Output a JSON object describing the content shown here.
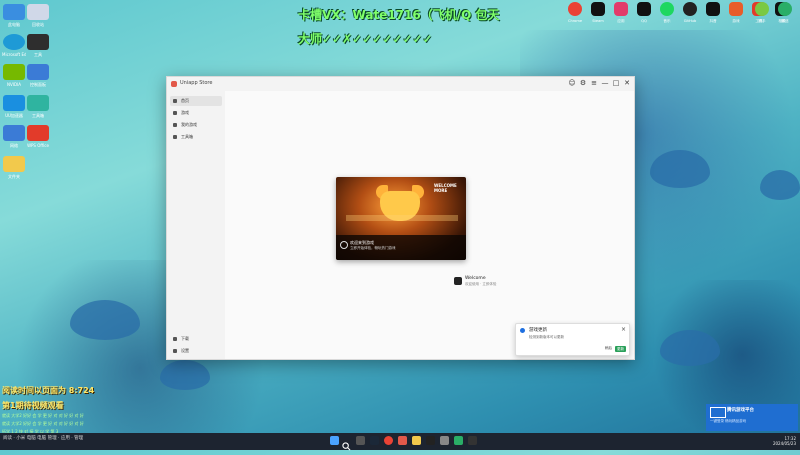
{
  "overlay": {
    "title_line1": "卡槽VX：Wate1716（飞机/Q 包天",
    "title_line2": "大师✓✓✗✓✓✓✓✓✓✓✓",
    "left_line1": "阅读时间以页面为 8:724",
    "left_line2": "第1期待视频观看",
    "left_small1": "就读 大学2 好好 会 学 更 好 对 对 好 好 对 好",
    "left_small2": "就读 大学2 好好 会 学 更 好 对 对 好 好 对 好",
    "left_small3": "拓学 1 2 快 对 接 学 以 学 第 3"
  },
  "desktop_icons": [
    {
      "label": "此电脑",
      "color": "#3a8ee0"
    },
    {
      "label": "回收站",
      "color": "#d0d8e8"
    },
    {
      "label": "Microsoft Edge",
      "color": "#1e9ad6"
    },
    {
      "label": "工具",
      "color": "#2e2e2e"
    },
    {
      "label": "NVIDIA",
      "color": "#76b900"
    },
    {
      "label": "控制面板",
      "color": "#3b7bd6"
    },
    {
      "label": "UU加速器",
      "color": "#1a8fe0"
    },
    {
      "label": "工具箱",
      "color": "#2fb4a0"
    },
    {
      "label": "网络",
      "color": "#3b7bd6"
    },
    {
      "label": "WPS Office",
      "color": "#e23b2a"
    },
    {
      "label": "文件夹",
      "color": "#f2c94c"
    }
  ],
  "top_icons": [
    {
      "label": "Chrome",
      "color": "#ea4335"
    },
    {
      "label": "Steam",
      "color": "#111111"
    },
    {
      "label": "应用",
      "color": "#e23b6a"
    },
    {
      "label": "QQ",
      "color": "#111111"
    },
    {
      "label": "音乐",
      "color": "#1ed760"
    },
    {
      "label": "GitHub",
      "color": "#222222"
    },
    {
      "label": "抖音",
      "color": "#111111"
    },
    {
      "label": "游戏",
      "color": "#e85d2a"
    },
    {
      "label": "工具",
      "color": "#e23b2a"
    },
    {
      "label": "相机",
      "color": "#111111"
    },
    {
      "label": "助手",
      "color": "#7ac943"
    },
    {
      "label": "微信",
      "color": "#2aae67"
    }
  ],
  "window": {
    "title": "Uniapp Store",
    "sidebar": [
      {
        "label": "首页",
        "active": true
      },
      {
        "label": "游戏",
        "active": false
      },
      {
        "label": "我的游戏",
        "active": false
      },
      {
        "label": "工具箱",
        "active": false
      }
    ],
    "sidebar_bottom": [
      {
        "label": "下载"
      },
      {
        "label": "设置"
      }
    ],
    "controls": {
      "minimize": "—",
      "maximize": "□",
      "close": "✕"
    }
  },
  "game_card": {
    "tag": "WELCOME MORE",
    "title": "欢迎来到游戏",
    "subtitle": "立即开始体验，畅玩热门游戏",
    "name": "Welcome",
    "name_sub": "欢迎使用 · 立即体验"
  },
  "toast": {
    "title": "游戏更新",
    "text": "检测到新版本可以更新",
    "secondary": "稍后",
    "primary": "更新"
  },
  "badge": {
    "title": "腾讯游戏平台",
    "sub": "一键登录 畅玩精品游戏"
  },
  "taskbar": {
    "left_text": "阅读 · 小米 电脑 电脑 管理 · 应用 · 管理",
    "time": "17:32",
    "date": "2024/05/23"
  }
}
